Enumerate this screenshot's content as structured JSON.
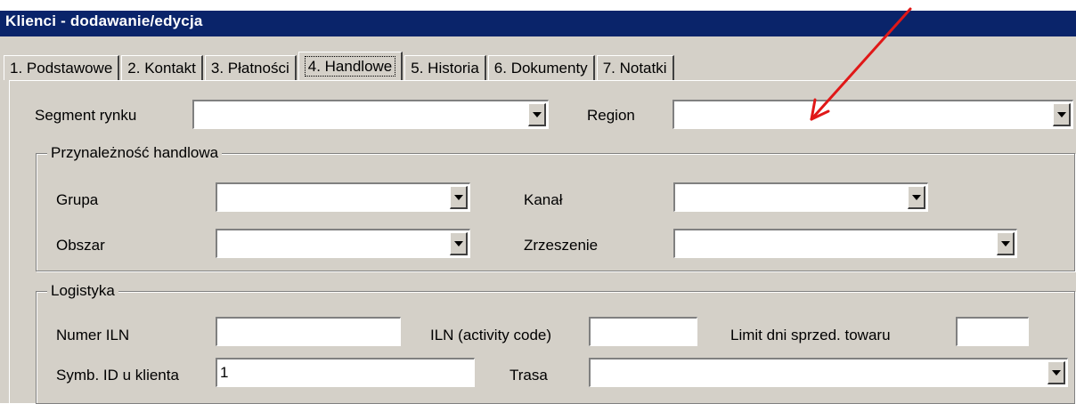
{
  "window": {
    "title": "Klienci - dodawanie/edycja"
  },
  "tabs": [
    {
      "label": "1. Podstawowe"
    },
    {
      "label": "2. Kontakt"
    },
    {
      "label": "3. Płatności"
    },
    {
      "label": "4. Handlowe",
      "active": true
    },
    {
      "label": "5. Historia"
    },
    {
      "label": "6. Dokumenty"
    },
    {
      "label": "7. Notatki"
    }
  ],
  "form": {
    "segment_label": "Segment rynku",
    "segment_value": "",
    "region_label": "Region",
    "region_value": ""
  },
  "przynaleznosc": {
    "legend": "Przynależność handlowa",
    "grupa_label": "Grupa",
    "grupa_value": "",
    "kanal_label": "Kanał",
    "kanal_value": "",
    "obszar_label": "Obszar",
    "obszar_value": "",
    "zrzeszenie_label": "Zrzeszenie",
    "zrzeszenie_value": ""
  },
  "logistyka": {
    "legend": "Logistyka",
    "numer_iln_label": "Numer ILN",
    "numer_iln_value": "",
    "iln_activity_label": "ILN (activity code)",
    "iln_activity_value": "",
    "limit_label": "Limit dni sprzed. towaru",
    "limit_value": "",
    "symb_label": "Symb. ID u klienta",
    "symb_value": "1",
    "trasa_label": "Trasa",
    "trasa_value": ""
  },
  "colors": {
    "titlebar": "#0a246a",
    "face": "#d4d0c8",
    "annotation_arrow": "#e01818"
  },
  "icons": {
    "dropdown": "chevron-down-icon"
  }
}
